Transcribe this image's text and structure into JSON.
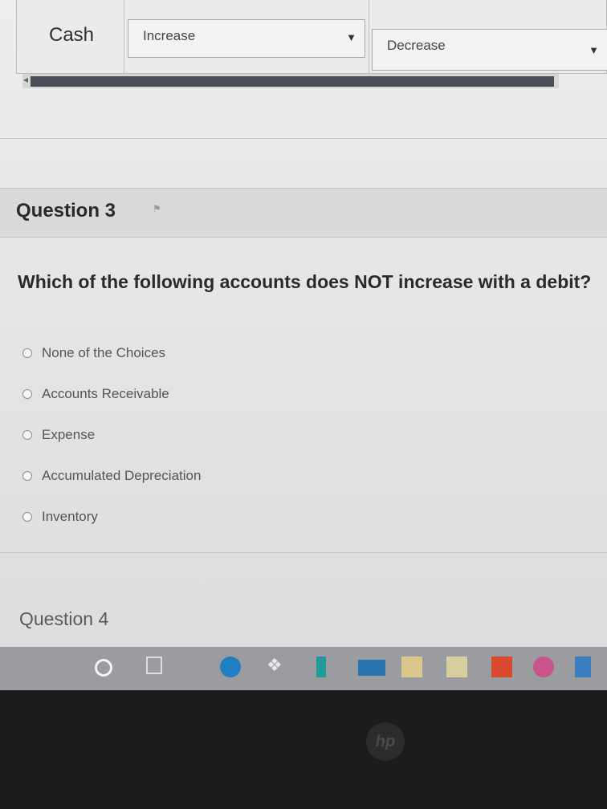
{
  "table": {
    "row_label": "Cash",
    "select_left": {
      "value": "Increase"
    },
    "select_right": {
      "value": "Decrease"
    }
  },
  "question3": {
    "title": "Question 3",
    "text": "Which of the following accounts does NOT increase with a debit?",
    "options": [
      "None of the Choices",
      "Accounts Receivable",
      "Expense",
      "Accumulated Depreciation",
      "Inventory"
    ]
  },
  "question4": {
    "title": "Question 4"
  },
  "icons": {
    "dropdown": "chevron-down-icon",
    "scroll_left": "arrow-left-icon"
  },
  "colors": {
    "scroll_thumb": "#4a4f58",
    "taskbar": "#9a9c9f",
    "edge": "#1f7fc2"
  }
}
